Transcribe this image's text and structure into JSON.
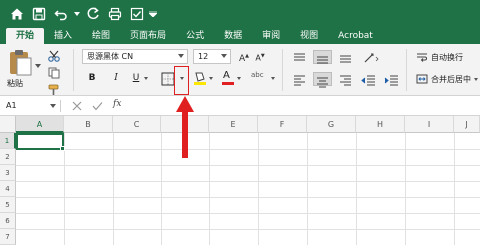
{
  "ribbon_tabs": [
    "开始",
    "插入",
    "绘图",
    "页面布局",
    "公式",
    "数据",
    "审阅",
    "视图",
    "Acrobat"
  ],
  "active_tab": "开始",
  "clipboard": {
    "paste_label": "粘贴"
  },
  "font": {
    "name": "思源黑体 CN",
    "size": "12"
  },
  "format_buttons": {
    "bold": "B",
    "italic": "I",
    "underline": "U",
    "font_color_letter": "A",
    "phonetic": "abc",
    "grow": "A",
    "shrink": "A"
  },
  "alignment": {
    "wrap_text": "自动换行",
    "merge_center": "合并后居中"
  },
  "formula_bar": {
    "name_box": "A1",
    "fx_label": "fx"
  },
  "grid": {
    "columns": [
      "A",
      "B",
      "C",
      "D",
      "E",
      "F",
      "G",
      "H",
      "I",
      "J"
    ],
    "rows": [
      "1",
      "2",
      "3",
      "4",
      "5",
      "6",
      "7"
    ],
    "active_cell": "A1"
  },
  "colors": {
    "brand": "#1f7246",
    "highlight": "#e02020",
    "fill_yellow": "#ffe600",
    "font_red": "#e02020"
  }
}
